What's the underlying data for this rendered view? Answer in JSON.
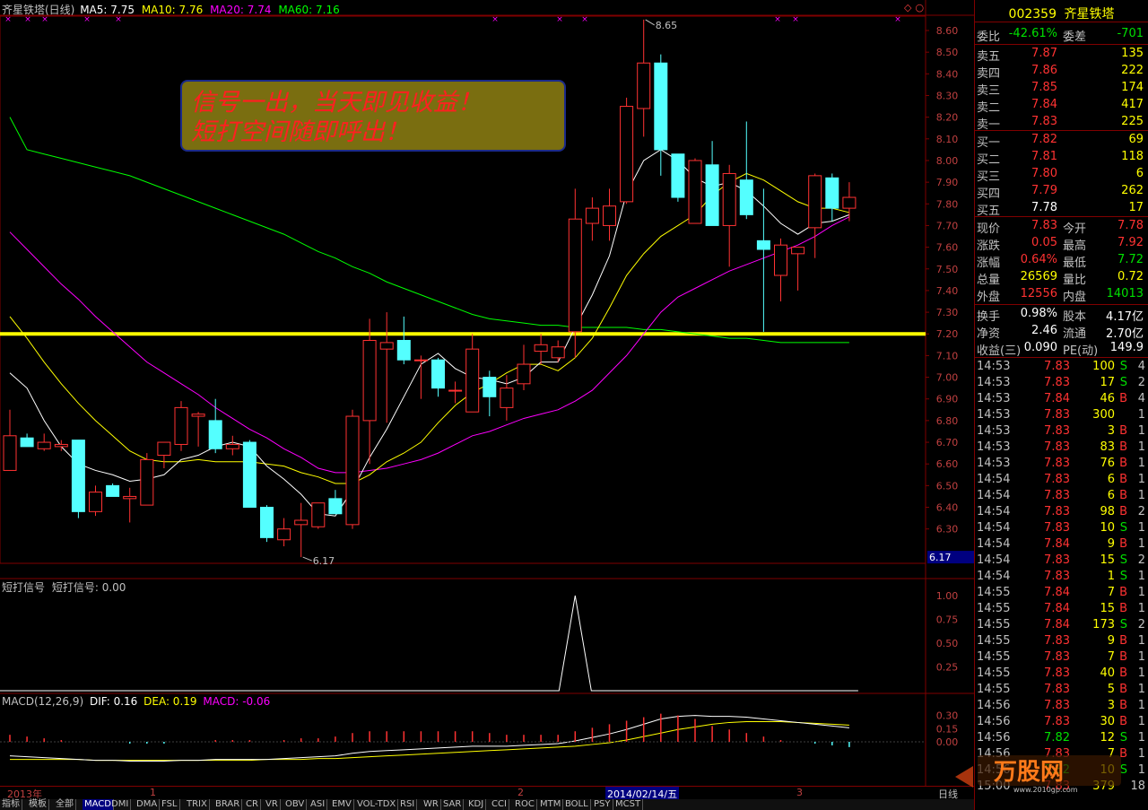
{
  "header": {
    "title": "齐星铁塔(日线)",
    "ma5": "MA5: 7.75",
    "ma10": "MA10: 7.76",
    "ma20": "MA20: 7.74",
    "ma60": "MA60: 7.16",
    "code": "002359",
    "name": "齐星铁塔"
  },
  "annotation": {
    "line1": "信号一出，当天即见收益！",
    "line2": "短打空间随即呼出！"
  },
  "price_axis": [
    "8.60",
    "8.50",
    "8.40",
    "8.30",
    "8.20",
    "8.10",
    "8.00",
    "7.90",
    "7.80",
    "7.70",
    "7.60",
    "7.50",
    "7.40",
    "7.30",
    "7.20",
    "7.10",
    "7.00",
    "6.90",
    "6.80",
    "6.70",
    "6.60",
    "6.50",
    "6.40",
    "6.30"
  ],
  "price_marks": {
    "high_label": "8.65",
    "low_label": "6.17",
    "current_tag": "6.17"
  },
  "signal_panel": {
    "title": "短打信号",
    "value": "短打信号: 0.00",
    "axis": [
      "1.00",
      "0.75",
      "0.50",
      "0.25"
    ]
  },
  "macd_panel": {
    "title": "MACD(12,26,9)",
    "dif": "DIF: 0.16",
    "dea": "DEA: 0.19",
    "macd": "MACD: -0.06",
    "axis": [
      "0.30",
      "0.15",
      "0.00"
    ]
  },
  "date_bar": {
    "year": "2013年",
    "m1": "1",
    "m2": "2",
    "cursor": "2014/02/14/五",
    "m3": "3",
    "period": "日线"
  },
  "order_book": {
    "weibi_label": "委比",
    "weibi": "-42.61%",
    "weicha_label": "委差",
    "weicha": "-701",
    "asks": [
      {
        "label": "卖五",
        "price": "7.87",
        "vol": "135"
      },
      {
        "label": "卖四",
        "price": "7.86",
        "vol": "222"
      },
      {
        "label": "卖三",
        "price": "7.85",
        "vol": "174"
      },
      {
        "label": "卖二",
        "price": "7.84",
        "vol": "417"
      },
      {
        "label": "卖一",
        "price": "7.83",
        "vol": "225"
      }
    ],
    "bids": [
      {
        "label": "买一",
        "price": "7.82",
        "vol": "69"
      },
      {
        "label": "买二",
        "price": "7.81",
        "vol": "118"
      },
      {
        "label": "买三",
        "price": "7.80",
        "vol": "6"
      },
      {
        "label": "买四",
        "price": "7.79",
        "vol": "262"
      },
      {
        "label": "买五",
        "price": "7.78",
        "vol": "17"
      }
    ]
  },
  "stats": [
    {
      "l1": "现价",
      "v1": "7.83",
      "l2": "今开",
      "v2": "7.78"
    },
    {
      "l1": "涨跌",
      "v1": "0.05",
      "l2": "最高",
      "v2": "7.92"
    },
    {
      "l1": "涨幅",
      "v1": "0.64%",
      "l2": "最低",
      "v2": "7.72"
    },
    {
      "l1": "总量",
      "v1": "26569",
      "l2": "量比",
      "v2": "0.72"
    },
    {
      "l1": "外盘",
      "v1": "12556",
      "l2": "内盘",
      "v2": "14013"
    },
    {
      "l1": "换手",
      "v1": "0.98%",
      "l2": "股本",
      "v2": "4.17亿"
    },
    {
      "l1": "净资",
      "v1": "2.46",
      "l2": "流通",
      "v2": "2.70亿"
    },
    {
      "l1": "收益(三)",
      "v1": "0.090",
      "l2": "PE(动)",
      "v2": "149.9"
    }
  ],
  "ticks": [
    {
      "t": "14:53",
      "p": "7.83",
      "v": "100",
      "s": "S",
      "n": "4"
    },
    {
      "t": "14:53",
      "p": "7.83",
      "v": "17",
      "s": "S",
      "n": "2"
    },
    {
      "t": "14:53",
      "p": "7.84",
      "v": "46",
      "s": "B",
      "n": "4"
    },
    {
      "t": "14:53",
      "p": "7.83",
      "v": "300",
      "s": "",
      "n": "1"
    },
    {
      "t": "14:53",
      "p": "7.83",
      "v": "3",
      "s": "B",
      "n": "1"
    },
    {
      "t": "14:53",
      "p": "7.83",
      "v": "83",
      "s": "B",
      "n": "1"
    },
    {
      "t": "14:53",
      "p": "7.83",
      "v": "76",
      "s": "B",
      "n": "1"
    },
    {
      "t": "14:54",
      "p": "7.83",
      "v": "6",
      "s": "B",
      "n": "1"
    },
    {
      "t": "14:54",
      "p": "7.83",
      "v": "6",
      "s": "B",
      "n": "1"
    },
    {
      "t": "14:54",
      "p": "7.83",
      "v": "98",
      "s": "B",
      "n": "2"
    },
    {
      "t": "14:54",
      "p": "7.83",
      "v": "10",
      "s": "S",
      "n": "1"
    },
    {
      "t": "14:54",
      "p": "7.84",
      "v": "9",
      "s": "B",
      "n": "1"
    },
    {
      "t": "14:54",
      "p": "7.83",
      "v": "15",
      "s": "S",
      "n": "2"
    },
    {
      "t": "14:54",
      "p": "7.83",
      "v": "1",
      "s": "S",
      "n": "1"
    },
    {
      "t": "14:55",
      "p": "7.84",
      "v": "7",
      "s": "B",
      "n": "1"
    },
    {
      "t": "14:55",
      "p": "7.84",
      "v": "15",
      "s": "B",
      "n": "1"
    },
    {
      "t": "14:55",
      "p": "7.84",
      "v": "173",
      "s": "S",
      "n": "2"
    },
    {
      "t": "14:55",
      "p": "7.83",
      "v": "9",
      "s": "B",
      "n": "1"
    },
    {
      "t": "14:55",
      "p": "7.83",
      "v": "7",
      "s": "B",
      "n": "1"
    },
    {
      "t": "14:55",
      "p": "7.83",
      "v": "40",
      "s": "B",
      "n": "1"
    },
    {
      "t": "14:55",
      "p": "7.83",
      "v": "5",
      "s": "B",
      "n": "1"
    },
    {
      "t": "14:56",
      "p": "7.83",
      "v": "3",
      "s": "B",
      "n": "1"
    },
    {
      "t": "14:56",
      "p": "7.83",
      "v": "30",
      "s": "B",
      "n": "1"
    },
    {
      "t": "14:56",
      "p": "7.82",
      "v": "12",
      "s": "S",
      "n": "1"
    },
    {
      "t": "14:56",
      "p": "7.83",
      "v": "7",
      "s": "B",
      "n": "1"
    },
    {
      "t": "14:56",
      "p": "7.82",
      "v": "10",
      "s": "S",
      "n": "1"
    },
    {
      "t": "15:00",
      "p": "7.83",
      "v": "379",
      "s": "",
      "n": "18"
    }
  ],
  "tabs": [
    "指标",
    "模板",
    "全部",
    "MACD",
    "DMI",
    "DMA",
    "FSL",
    "TRIX",
    "BRAR",
    "CR",
    "VR",
    "OBV",
    "ASI",
    "EMV",
    "VOL-TDX",
    "RSI",
    "WR",
    "SAR",
    "KDJ",
    "CCI",
    "ROC",
    "MTM",
    "BOLL",
    "PSY",
    "MCST"
  ],
  "active_tab": "MACD",
  "colors": {
    "up": "#ff3232",
    "down": "#54ffff",
    "ma5": "#ffffff",
    "ma10": "#ffff00",
    "ma20": "#ff00ff",
    "ma60": "#00ff00",
    "support": "#ffff00",
    "grid": "#800000"
  },
  "chart_data": {
    "type": "candlestick",
    "ylim": [
      6.17,
      8.65
    ],
    "support_level": 7.2,
    "candles": [
      {
        "o": 6.57,
        "h": 6.85,
        "l": 6.71,
        "c": 6.73
      },
      {
        "o": 6.72,
        "h": 6.74,
        "l": 6.68,
        "c": 6.68
      },
      {
        "o": 6.67,
        "h": 6.74,
        "l": 6.66,
        "c": 6.7
      },
      {
        "o": 6.68,
        "h": 6.71,
        "l": 6.66,
        "c": 6.69
      },
      {
        "o": 6.71,
        "h": 6.71,
        "l": 6.35,
        "c": 6.38
      },
      {
        "o": 6.38,
        "h": 6.5,
        "l": 6.36,
        "c": 6.47
      },
      {
        "o": 6.5,
        "h": 6.51,
        "l": 6.45,
        "c": 6.45
      },
      {
        "o": 6.44,
        "h": 6.49,
        "l": 6.33,
        "c": 6.45
      },
      {
        "o": 6.41,
        "h": 6.65,
        "l": 6.41,
        "c": 6.62
      },
      {
        "o": 6.64,
        "h": 6.7,
        "l": 6.58,
        "c": 6.7
      },
      {
        "o": 6.69,
        "h": 6.89,
        "l": 6.66,
        "c": 6.86
      },
      {
        "o": 6.82,
        "h": 6.84,
        "l": 6.68,
        "c": 6.83
      },
      {
        "o": 6.8,
        "h": 6.9,
        "l": 6.65,
        "c": 6.67
      },
      {
        "o": 6.67,
        "h": 6.73,
        "l": 6.64,
        "c": 6.69
      },
      {
        "o": 6.7,
        "h": 6.71,
        "l": 6.4,
        "c": 6.4
      },
      {
        "o": 6.4,
        "h": 6.41,
        "l": 6.24,
        "c": 6.26
      },
      {
        "o": 6.25,
        "h": 6.35,
        "l": 6.22,
        "c": 6.3
      },
      {
        "o": 6.32,
        "h": 6.42,
        "l": 6.17,
        "c": 6.34
      },
      {
        "o": 6.31,
        "h": 6.42,
        "l": 6.3,
        "c": 6.42
      },
      {
        "o": 6.44,
        "h": 6.48,
        "l": 6.37,
        "c": 6.37
      },
      {
        "o": 6.32,
        "h": 6.85,
        "l": 6.3,
        "c": 6.82
      },
      {
        "o": 6.8,
        "h": 7.27,
        "l": 6.6,
        "c": 7.17
      },
      {
        "o": 7.13,
        "h": 7.3,
        "l": 6.79,
        "c": 7.16
      },
      {
        "o": 7.17,
        "h": 7.28,
        "l": 7.06,
        "c": 7.08
      },
      {
        "o": 7.08,
        "h": 7.1,
        "l": 6.9,
        "c": 7.08
      },
      {
        "o": 7.08,
        "h": 7.09,
        "l": 6.91,
        "c": 6.95
      },
      {
        "o": 6.94,
        "h": 6.98,
        "l": 6.88,
        "c": 6.94
      },
      {
        "o": 6.84,
        "h": 7.2,
        "l": 6.85,
        "c": 7.13
      },
      {
        "o": 7.0,
        "h": 7.03,
        "l": 6.82,
        "c": 6.91
      },
      {
        "o": 6.86,
        "h": 7.01,
        "l": 6.8,
        "c": 6.95
      },
      {
        "o": 6.97,
        "h": 7.15,
        "l": 6.94,
        "c": 7.06
      },
      {
        "o": 7.12,
        "h": 7.2,
        "l": 7.06,
        "c": 7.15
      },
      {
        "o": 7.09,
        "h": 7.17,
        "l": 7.07,
        "c": 7.14
      },
      {
        "o": 7.21,
        "h": 7.87,
        "l": 7.09,
        "c": 7.73
      },
      {
        "o": 7.71,
        "h": 7.83,
        "l": 7.63,
        "c": 7.78
      },
      {
        "o": 7.7,
        "h": 7.87,
        "l": 7.63,
        "c": 7.79
      },
      {
        "o": 7.81,
        "h": 8.29,
        "l": 7.8,
        "c": 8.25
      },
      {
        "o": 8.24,
        "h": 8.65,
        "l": 8.11,
        "c": 8.45
      },
      {
        "o": 8.45,
        "h": 8.49,
        "l": 7.93,
        "c": 8.05
      },
      {
        "o": 8.03,
        "h": 8.01,
        "l": 7.81,
        "c": 7.83
      },
      {
        "o": 7.71,
        "h": 8.01,
        "l": 7.81,
        "c": 8.0
      },
      {
        "o": 7.98,
        "h": 8.09,
        "l": 7.7,
        "c": 7.7
      },
      {
        "o": 7.7,
        "h": 7.98,
        "l": 7.51,
        "c": 7.94
      },
      {
        "o": 7.91,
        "h": 8.18,
        "l": 7.73,
        "c": 7.75
      },
      {
        "o": 7.63,
        "h": 7.87,
        "l": 7.21,
        "c": 7.59
      },
      {
        "o": 7.47,
        "h": 7.64,
        "l": 7.35,
        "c": 7.61
      },
      {
        "o": 7.57,
        "h": 7.6,
        "l": 7.4,
        "c": 7.6
      },
      {
        "o": 7.69,
        "h": 7.94,
        "l": 7.55,
        "c": 7.93
      },
      {
        "o": 7.92,
        "h": 7.94,
        "l": 7.72,
        "c": 7.78
      },
      {
        "o": 7.78,
        "h": 7.9,
        "l": 7.72,
        "c": 7.83
      }
    ],
    "ma5": [
      7.02,
      6.95,
      6.8,
      6.68,
      6.6,
      6.57,
      6.55,
      6.52,
      6.53,
      6.55,
      6.62,
      6.64,
      6.68,
      6.7,
      6.68,
      6.59,
      6.53,
      6.46,
      6.37,
      6.36,
      6.48,
      6.63,
      6.76,
      6.91,
      7.06,
      7.11,
      7.04,
      7.0,
      6.99,
      6.97,
      7.0,
      7.07,
      7.07,
      7.23,
      7.38,
      7.56,
      7.85,
      8.0,
      8.05,
      8.0,
      7.92,
      7.88,
      7.9,
      7.86,
      7.79,
      7.71,
      7.66,
      7.71,
      7.72,
      7.75
    ],
    "ma10": [
      7.28,
      7.18,
      7.07,
      6.97,
      6.88,
      6.8,
      6.73,
      6.66,
      6.62,
      6.61,
      6.61,
      6.62,
      6.61,
      6.61,
      6.61,
      6.6,
      6.59,
      6.56,
      6.54,
      6.51,
      6.51,
      6.55,
      6.61,
      6.65,
      6.7,
      6.79,
      6.87,
      6.93,
      6.97,
      7.02,
      7.06,
      7.06,
      7.03,
      7.09,
      7.18,
      7.32,
      7.47,
      7.57,
      7.65,
      7.7,
      7.75,
      7.84,
      7.9,
      7.94,
      7.91,
      7.86,
      7.81,
      7.78,
      7.78,
      7.76
    ],
    "ma20": [
      7.67,
      7.59,
      7.51,
      7.43,
      7.36,
      7.28,
      7.21,
      7.14,
      7.07,
      7.02,
      6.97,
      6.92,
      6.86,
      6.81,
      6.76,
      6.72,
      6.67,
      6.63,
      6.58,
      6.56,
      6.56,
      6.57,
      6.58,
      6.6,
      6.62,
      6.65,
      6.69,
      6.73,
      6.75,
      6.78,
      6.81,
      6.83,
      6.85,
      6.89,
      6.94,
      7.02,
      7.1,
      7.2,
      7.3,
      7.37,
      7.41,
      7.45,
      7.49,
      7.52,
      7.55,
      7.58,
      7.61,
      7.65,
      7.7,
      7.74
    ],
    "ma60": [
      8.2,
      8.05,
      8.03,
      8.01,
      7.99,
      7.97,
      7.95,
      7.93,
      7.9,
      7.87,
      7.84,
      7.81,
      7.78,
      7.75,
      7.72,
      7.69,
      7.66,
      7.62,
      7.58,
      7.55,
      7.51,
      7.48,
      7.44,
      7.41,
      7.38,
      7.35,
      7.32,
      7.29,
      7.27,
      7.26,
      7.25,
      7.24,
      7.24,
      7.23,
      7.23,
      7.23,
      7.23,
      7.22,
      7.22,
      7.21,
      7.2,
      7.19,
      7.18,
      7.18,
      7.17,
      7.16,
      7.16,
      7.16,
      7.16,
      7.16
    ],
    "signal": {
      "ylim": [
        0,
        1
      ],
      "spike_index": 33,
      "value": 1.0
    },
    "macd": {
      "ylim": [
        -0.25,
        0.35
      ],
      "dif": [
        -0.16,
        -0.17,
        -0.18,
        -0.19,
        -0.2,
        -0.21,
        -0.21,
        -0.22,
        -0.22,
        -0.22,
        -0.21,
        -0.21,
        -0.2,
        -0.2,
        -0.2,
        -0.2,
        -0.19,
        -0.18,
        -0.17,
        -0.16,
        -0.13,
        -0.11,
        -0.1,
        -0.09,
        -0.08,
        -0.07,
        -0.06,
        -0.05,
        -0.05,
        -0.05,
        -0.04,
        -0.03,
        -0.02,
        0.01,
        0.05,
        0.09,
        0.14,
        0.2,
        0.26,
        0.29,
        0.3,
        0.29,
        0.29,
        0.28,
        0.26,
        0.24,
        0.22,
        0.2,
        0.18,
        0.16
      ],
      "dea": [
        -0.2,
        -0.2,
        -0.2,
        -0.2,
        -0.2,
        -0.21,
        -0.21,
        -0.21,
        -0.21,
        -0.21,
        -0.21,
        -0.21,
        -0.21,
        -0.21,
        -0.21,
        -0.2,
        -0.2,
        -0.2,
        -0.19,
        -0.19,
        -0.18,
        -0.17,
        -0.16,
        -0.15,
        -0.14,
        -0.13,
        -0.12,
        -0.11,
        -0.1,
        -0.09,
        -0.08,
        -0.07,
        -0.06,
        -0.05,
        -0.03,
        -0.01,
        0.02,
        0.06,
        0.1,
        0.14,
        0.17,
        0.2,
        0.22,
        0.23,
        0.23,
        0.23,
        0.22,
        0.21,
        0.2,
        0.19
      ]
    }
  }
}
